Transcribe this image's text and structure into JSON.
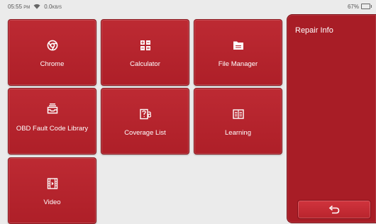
{
  "status_bar": {
    "time": "05:55",
    "time_suffix": "PM",
    "net_speed": "0.0",
    "net_unit": "KB/S",
    "battery": "67%",
    "icons": [
      "wifi-icon",
      "battery-icon"
    ]
  },
  "tiles": [
    {
      "label": "Chrome",
      "icon": "chrome-icon"
    },
    {
      "label": "Calculator",
      "icon": "calculator-icon"
    },
    {
      "label": "File Manager",
      "icon": "folder-icon"
    },
    {
      "label": "OBD Fault Code Library",
      "icon": "inbox-icon"
    },
    {
      "label": "Coverage List",
      "icon": "coverage-list-icon"
    },
    {
      "label": "Learning",
      "icon": "learning-icon"
    },
    {
      "label": "Video",
      "icon": "film-icon"
    }
  ],
  "repair_panel": {
    "title": "Repair Info",
    "back_icon": "back-arrow-icon"
  },
  "colors": {
    "tile_red": "#b4232c",
    "panel_red": "#a81d26",
    "background": "#ebebeb"
  }
}
